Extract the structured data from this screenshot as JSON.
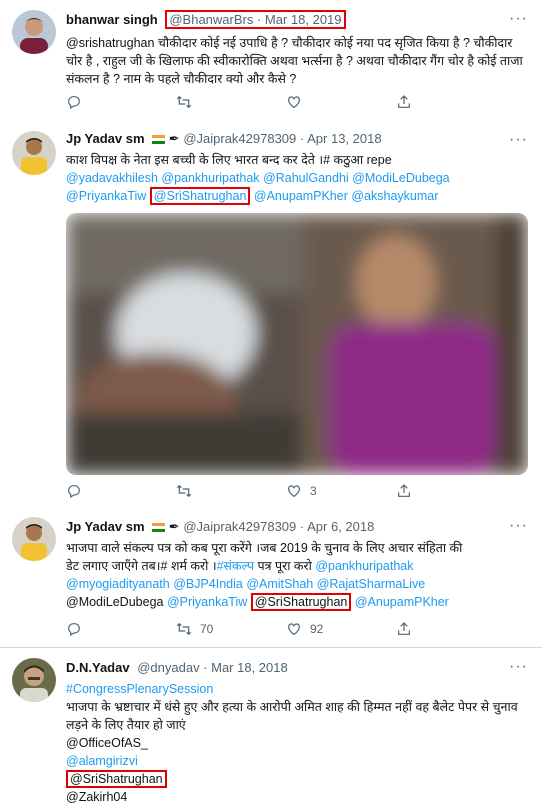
{
  "tweets": [
    {
      "name": "bhanwar singh",
      "handle_date": "@BhanwarBrs · Mar 18, 2019",
      "text": "@srishatrughan चौकीदार कोई नई उपाधि है ?  चौकीदार कोई नया पद सृजित किया है ?  चौकीदार चोर है , राहुल जी के खिलाफ की स्वीकारोक्ति अथवा भर्त्सना है ? अथवा चौकीदार गैंग चोर है कोई ताजा संकलन है ? नाम के पहले चौकीदार क्यो और कैसे ?",
      "reply_count": "",
      "retweet_count": "",
      "like_count": ""
    },
    {
      "name": "Jp Yadav sm",
      "handle": "@Jaiprak42978309",
      "date": "· Apr 13, 2018",
      "text_line1": "काश विपक्ष के नेता इस बच्ची के लिए भारत बन्द कर देते ।# कठुआ  repe",
      "mentions_line2": "@yadavakhilesh @pankhuripathak @RahulGandhi @ModiLeDubega",
      "mention_a": "@PriyankaTiw",
      "mention_highlight": "@SriShatrughan",
      "mentions_rest": "@AnupamPKher @akshaykumar",
      "reply_count": "",
      "retweet_count": "",
      "like_count": "3"
    },
    {
      "name": "Jp Yadav sm",
      "handle": "@Jaiprak42978309",
      "date": "· Apr 6, 2018",
      "text_line1": "भाजपा वाले संकल्प पत्र को कब पूरा करेंगे ।जब 2019 के चुनाव के लिए अचार संहिता की",
      "text_line2a": "डेट लगाए जाएँगे तब।# शर्म करो ।",
      "tag": "#संकल्प",
      "text_line2b": " पत्र पूरा करो ",
      "mention_p": "@pankhuripathak",
      "mentions_line3": "@myogiadityanath @BJP4India @AmitShah @RajatSharmaLive",
      "mention_plain": "@ModiLeDubega",
      "mention_b": "@PriyankaTiw",
      "mention_highlight": "@SriShatrughan",
      "mention_c": "@AnupamPKher",
      "reply_count": "",
      "retweet_count": "70",
      "like_count": "92"
    },
    {
      "name": "D.N.Yadav",
      "handle_date": "@dnyadav · Mar 18, 2018",
      "tag": "#CongressPlenarySession",
      "text_line": "भाजपा के भ्रष्टाचार में धंसे हुए और हत्या के आरोपी अमित शाह की हिम्मत नहीं वह बैलेट पेपर से चुनाव लड़ने के लिए तैयार हो जाएं",
      "m1": "@OfficeOfAS_",
      "m2": "@alamgirizvi",
      "m3": "@SriShatrughan",
      "m4": "@Zakirh04"
    }
  ],
  "more_label": "···",
  "colors": {
    "link": "#1d9bf0",
    "highlight_border": "#e00000",
    "muted": "#536471"
  }
}
